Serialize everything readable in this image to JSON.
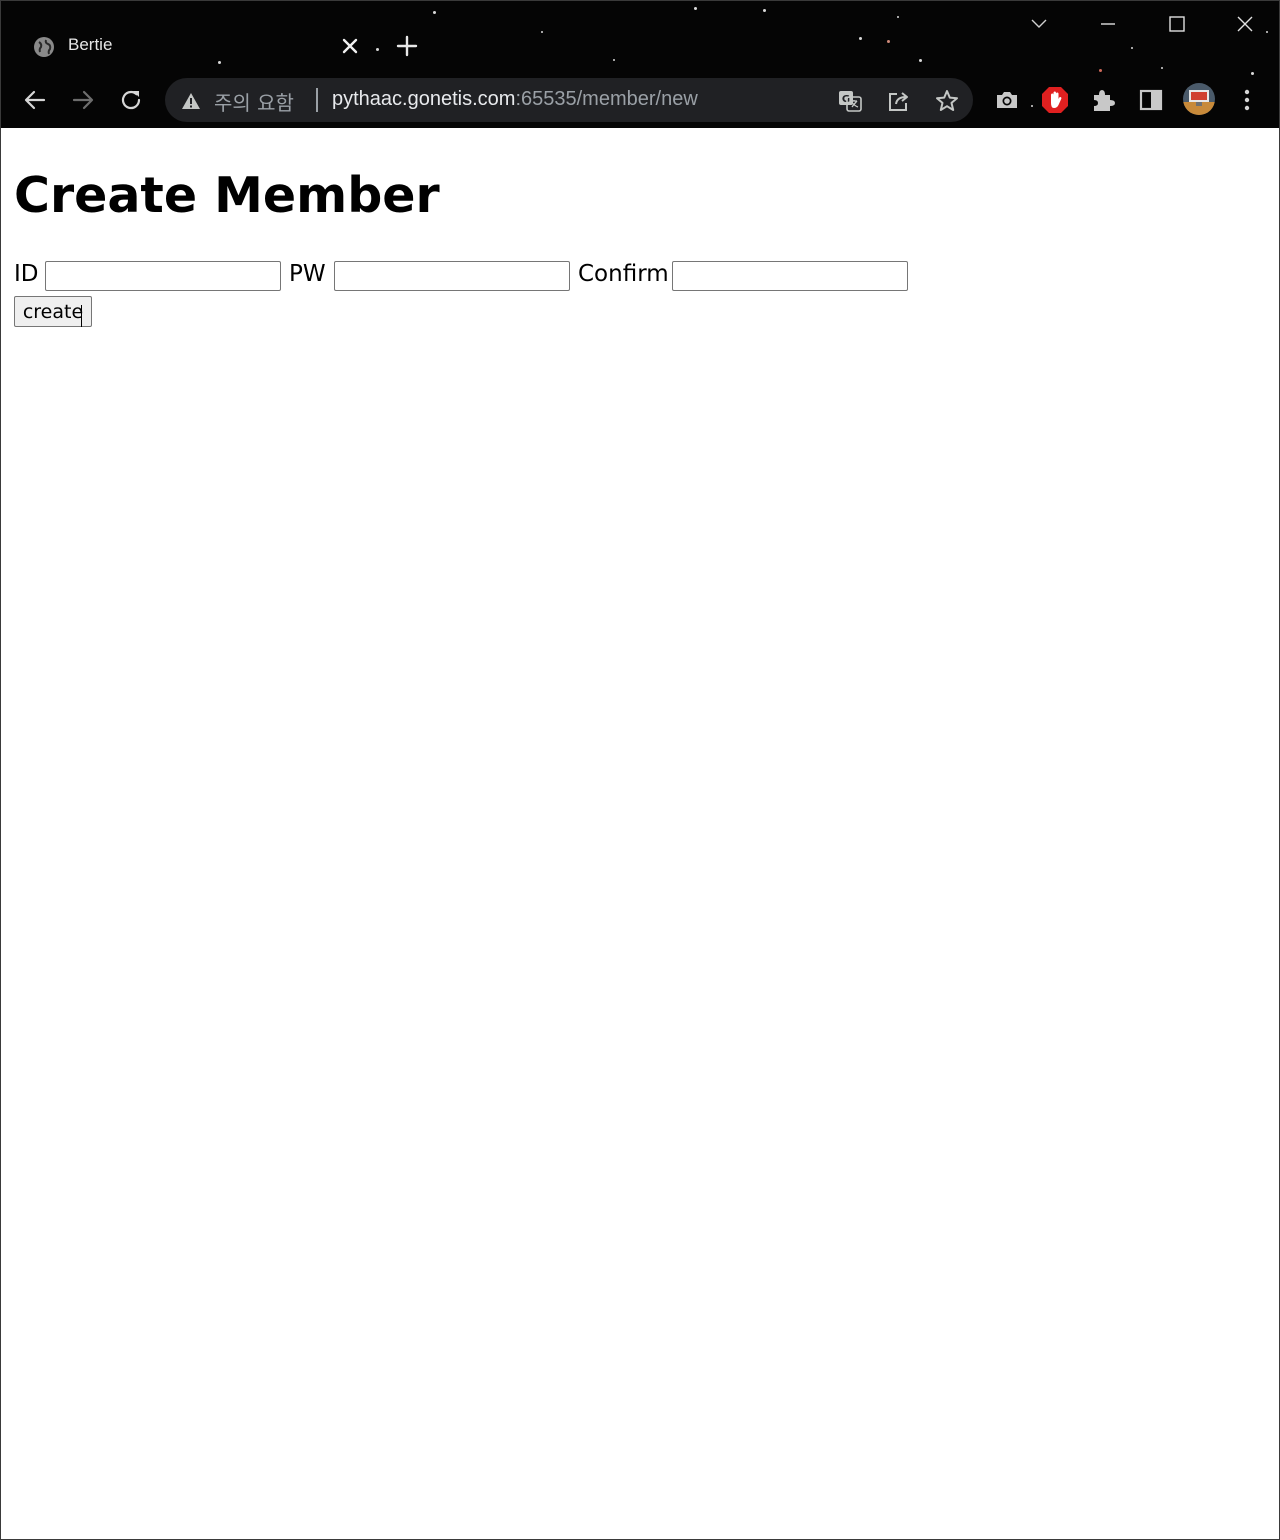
{
  "browser": {
    "tab": {
      "title": "Bertie",
      "favicon": "globe-icon",
      "close_icon": "close-icon"
    },
    "new_tab_icon": "plus-icon",
    "window_controls": [
      "chevron-down-icon",
      "minimize-icon",
      "maximize-icon",
      "close-window-icon"
    ],
    "toolbar": {
      "back_icon": "back-arrow-icon",
      "forward_icon": "forward-arrow-icon",
      "reload_icon": "reload-icon"
    },
    "omnibox": {
      "security_icon": "warning-icon",
      "security_text": "주의 요함",
      "url_host": "pythaac.gonetis.com",
      "url_rest": ":65535/member/new",
      "icons": [
        "translate-icon",
        "share-icon",
        "star-icon"
      ]
    },
    "extensions": [
      "camera-icon",
      "stop-hand-icon",
      "puzzle-icon",
      "side-panel-icon",
      "profile-avatar",
      "more-menu-icon"
    ],
    "colors": {
      "chrome_bg": "#050505",
      "omnibox_bg": "#202124",
      "stop_extension_red": "#e02020"
    }
  },
  "page": {
    "title": "Create Member",
    "form": {
      "id_label": "ID",
      "id_value": "",
      "pw_label": "PW",
      "pw_value": "",
      "confirm_label": "Confirm",
      "confirm_value": "",
      "submit_label": "create"
    }
  }
}
